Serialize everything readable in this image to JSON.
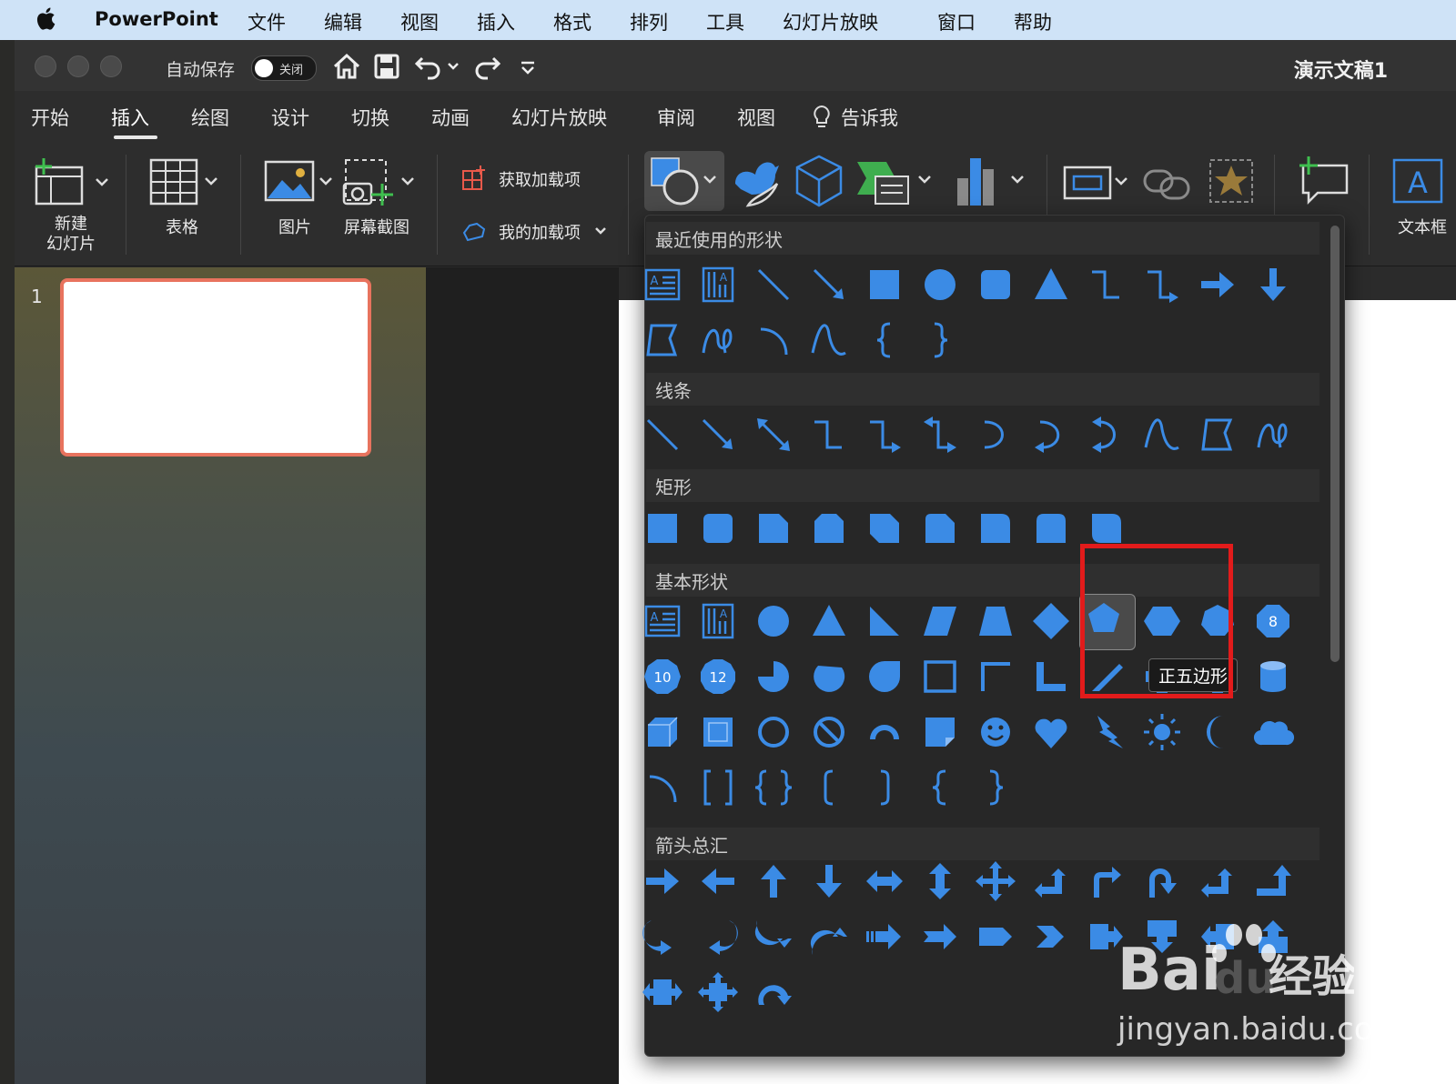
{
  "menubar": {
    "apple": "",
    "app": "PowerPoint",
    "items": [
      "文件",
      "编辑",
      "视图",
      "插入",
      "格式",
      "排列",
      "工具",
      "幻灯片放映",
      "窗口",
      "帮助"
    ]
  },
  "titlebar": {
    "autosave_label": "自动保存",
    "autosave_state": "关闭",
    "doc_title": "演示文稿1"
  },
  "tabs": [
    "开始",
    "插入",
    "绘图",
    "设计",
    "切换",
    "动画",
    "幻灯片放映",
    "审阅",
    "视图",
    "告诉我"
  ],
  "ribbon": {
    "new_slide": "新建\n幻灯片",
    "table": "表格",
    "picture": "图片",
    "screenshot": "屏幕截图",
    "get_addins": "获取加载项",
    "my_addins": "我的加载项",
    "textbox": "文本框"
  },
  "slides": {
    "number": "1"
  },
  "gallery": {
    "sections": {
      "recent": "最近使用的形状",
      "lines": "线条",
      "rect": "矩形",
      "basic": "基本形状",
      "arrows": "箭头总汇"
    },
    "octagon_label": "8",
    "decagon_label": "10",
    "dodecagon_label": "12",
    "tooltip": "正五边形"
  },
  "watermark": {
    "logo": "Bai\u0000经验",
    "brand": "Bai",
    "du": "du",
    "jingyan": "经验",
    "url": "jingyan.baidu.com"
  },
  "colors": {
    "accent": "#3b8be5",
    "highlight": "#e21b1b"
  }
}
